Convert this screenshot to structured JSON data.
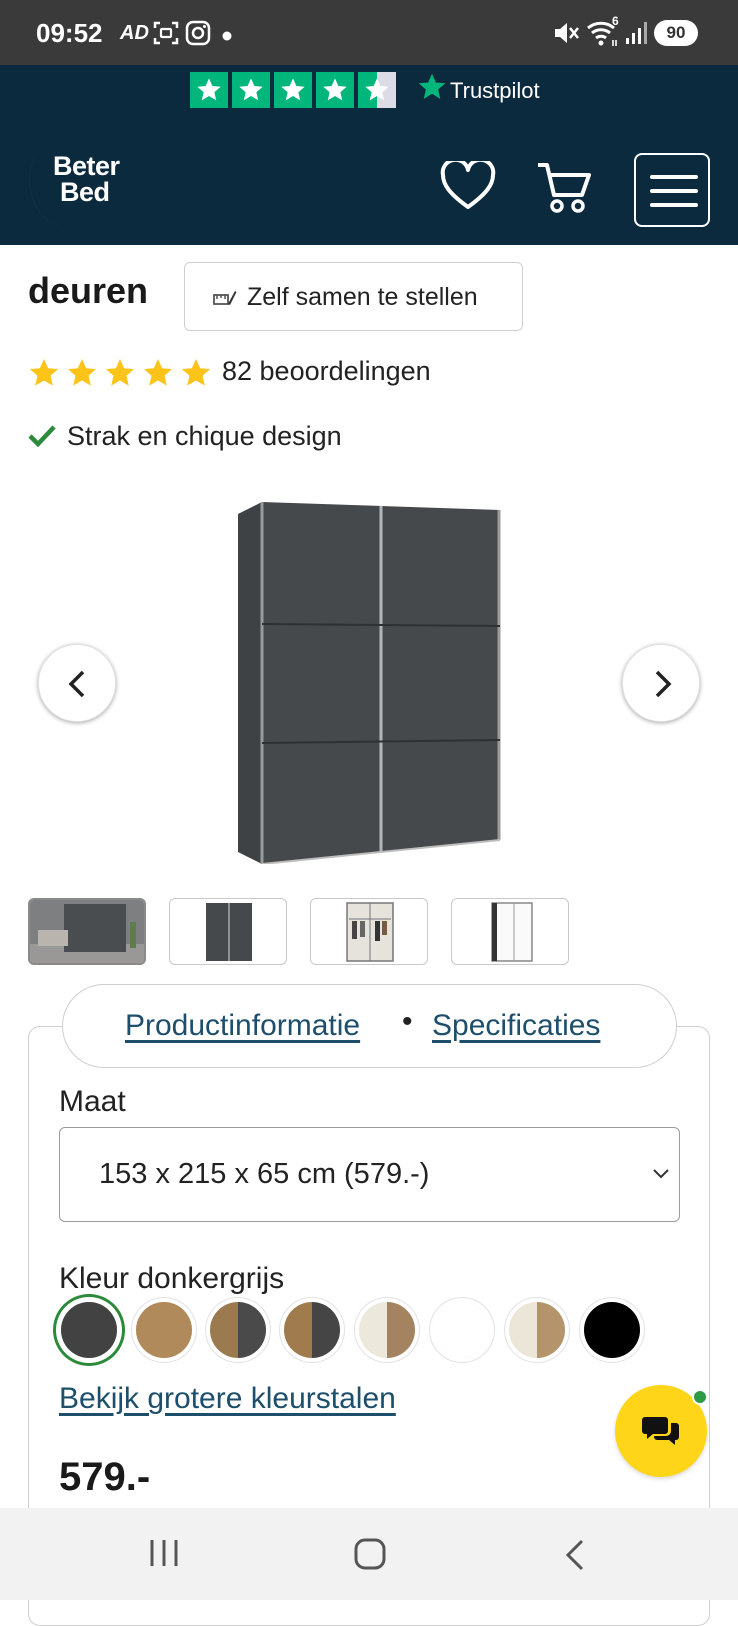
{
  "status_bar": {
    "time": "09:52",
    "app_badge": "AD",
    "battery": "90",
    "wifi_badge": "6",
    "icons": [
      "screenshot-icon",
      "instagram-icon",
      "dot-icon",
      "mute-icon",
      "wifi-icon",
      "signal-icon",
      "battery-icon"
    ]
  },
  "trustpilot": {
    "label": "Trustpilot",
    "stars": 4.5,
    "color": "#00b67a"
  },
  "header": {
    "logo_line1": "Beter",
    "logo_line2": "Bed",
    "background": "#0c2a3e",
    "icons": [
      "heart-icon",
      "cart-icon",
      "menu-icon"
    ]
  },
  "product": {
    "title": "deuren",
    "config_button": "Zelf samen te stellen",
    "rating_stars": 5,
    "rating_text": "82 beoordelingen",
    "usp": "Strak en chique design",
    "thumbnail_count": 4,
    "active_thumbnail": 1
  },
  "info": {
    "tab_product": "Productinformatie",
    "tab_separator": "•",
    "tab_specs": "Specificaties",
    "size_label": "Maat",
    "size_value": "153 x 215 x 65 cm (579.-)",
    "color_label": "Kleur donkergrijs",
    "swatches": [
      {
        "left": "#424242",
        "right": "#424242",
        "selected": true
      },
      {
        "left": "#b08a5a",
        "right": "#b08a5a",
        "selected": false
      },
      {
        "left": "#9c7a50",
        "right": "#4a4a4a",
        "selected": false
      },
      {
        "left": "#a07b4e",
        "right": "#454545",
        "selected": false
      },
      {
        "left": "#ede8dc",
        "right": "#a48360",
        "selected": false
      },
      {
        "left": "#ffffff",
        "right": "#ffffff",
        "selected": false
      },
      {
        "left": "#ece6d8",
        "right": "#b3946b",
        "selected": false
      },
      {
        "left": "#000000",
        "right": "#000000",
        "selected": false
      }
    ],
    "swatch_link": "Bekijk grotere kleurstalen",
    "price": "579.-"
  },
  "colors": {
    "link": "#1d4e6b",
    "star": "#fcc419",
    "check": "#2c8a3a",
    "chat": "#ffd51a"
  }
}
